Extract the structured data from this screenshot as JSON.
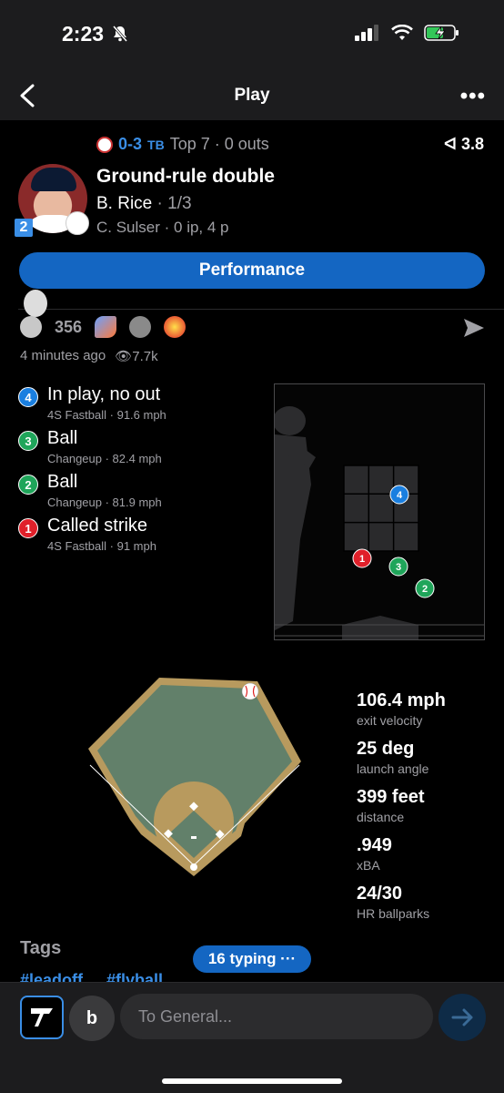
{
  "status_bar": {
    "time": "2:23"
  },
  "nav": {
    "title": "Play"
  },
  "play": {
    "score": "0-3",
    "inning": "Top 7 · 0 outs",
    "pressure": "3.8",
    "title": "Ground-rule double",
    "batter": "B. Rice",
    "batter_stat": "· 1/3",
    "pitcher_line": "C. Sulser · 0 ip, 4 p",
    "jersey_number": "2"
  },
  "performance_button": "Performance",
  "reactions": {
    "count": "356"
  },
  "meta": {
    "time_ago": "4 minutes ago",
    "views": "7.7k"
  },
  "pitches": [
    {
      "number": "4",
      "result": "In play, no out",
      "detail": "4S Fastball · 91.6 mph",
      "color": "#1a7fe0"
    },
    {
      "number": "3",
      "result": "Ball",
      "detail": "Changeup · 82.4 mph",
      "color": "#1fa55a"
    },
    {
      "number": "2",
      "result": "Ball",
      "detail": "Changeup · 81.9 mph",
      "color": "#1fa55a"
    },
    {
      "number": "1",
      "result": "Called strike",
      "detail": "4S Fastball · 91 mph",
      "color": "#e0202a"
    }
  ],
  "stats": [
    {
      "value": "106.4 mph",
      "label": "exit velocity"
    },
    {
      "value": "25 deg",
      "label": "launch angle"
    },
    {
      "value": "399 feet",
      "label": "distance"
    },
    {
      "value": ".949",
      "label": "xBA"
    },
    {
      "value": "24/30",
      "label": "HR ballparks"
    }
  ],
  "tags": {
    "title": "Tags",
    "items": [
      "#leadoff",
      "#flyball"
    ]
  },
  "typing": {
    "label": "16 typing ···"
  },
  "composer": {
    "b_label": "b",
    "placeholder": "To General..."
  },
  "colors": {
    "accent": "#1466c2",
    "link": "#3a8ee6",
    "ball": "#1fa55a",
    "strike": "#e0202a",
    "in_play": "#1a7fe0"
  }
}
